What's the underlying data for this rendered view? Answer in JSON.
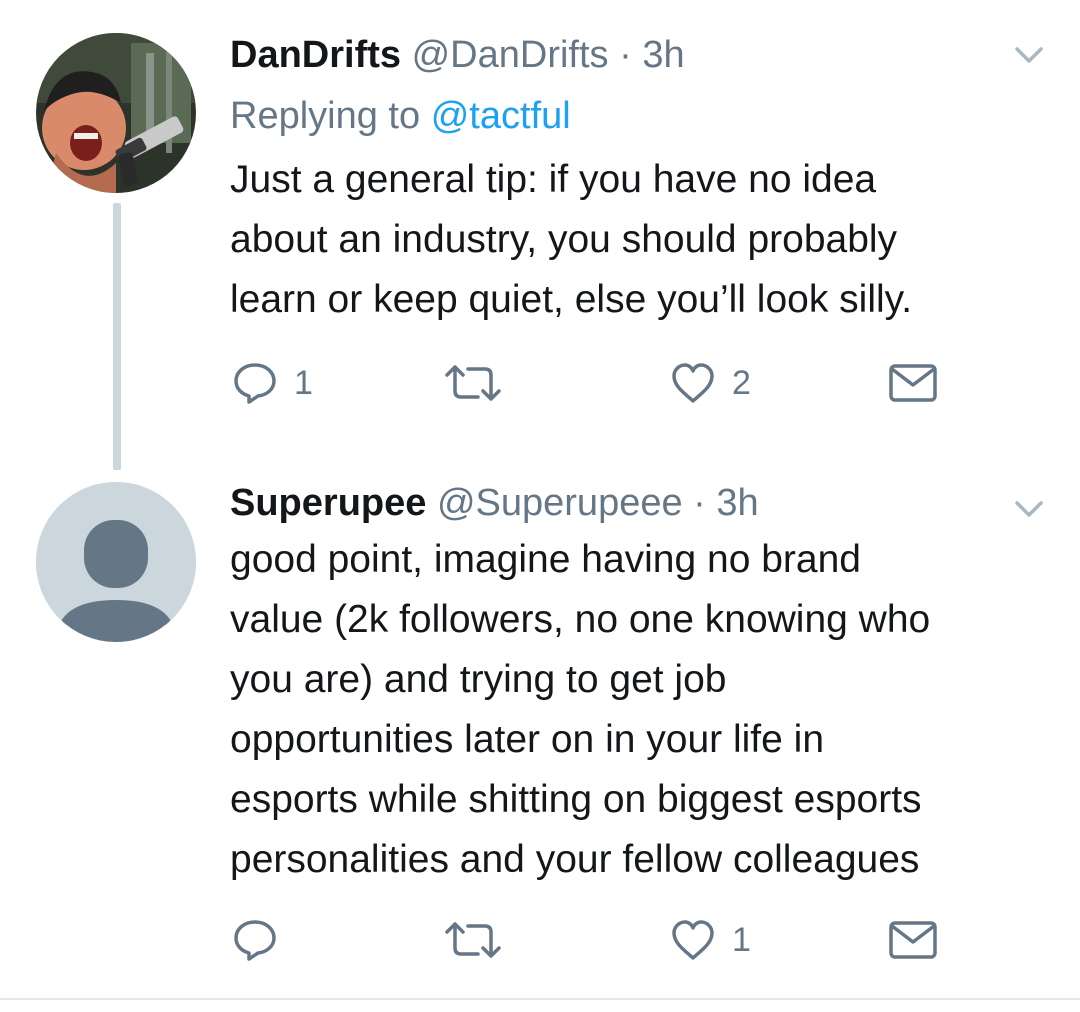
{
  "tweets": [
    {
      "display_name": "DanDrifts",
      "handle": "@DanDrifts",
      "separator": "·",
      "time": "3h",
      "replying_prefix": "Replying to",
      "replying_mention": "@tactful",
      "body_lines": [
        "Just a general tip: if you have no idea",
        "about an industry, you should probably",
        "learn or keep quiet, else you’ll look silly."
      ],
      "reply_count": "1",
      "retweet_count": "",
      "like_count": "2",
      "avatar": "user-photo"
    },
    {
      "display_name": "Superupee",
      "handle": "@Superupeee",
      "separator": "·",
      "time": "3h",
      "body_lines": [
        "good point, imagine having no brand",
        "value (2k followers, no one knowing who",
        "you are) and trying to get job",
        "opportunities later on in your life in",
        "esports while shitting on biggest esports",
        "personalities and your fellow colleagues"
      ],
      "reply_count": "",
      "retweet_count": "",
      "like_count": "1",
      "avatar": "default-avatar"
    }
  ],
  "icons": {
    "reply": "reply-icon",
    "retweet": "retweet-icon",
    "like": "heart-icon",
    "dm": "envelope-icon",
    "menu": "chevron-down-icon"
  },
  "colors": {
    "text": "#14171a",
    "secondary": "#657786",
    "link": "#1da1f2",
    "thread_line": "#ccd6dd",
    "divider": "#e1e8ed"
  }
}
